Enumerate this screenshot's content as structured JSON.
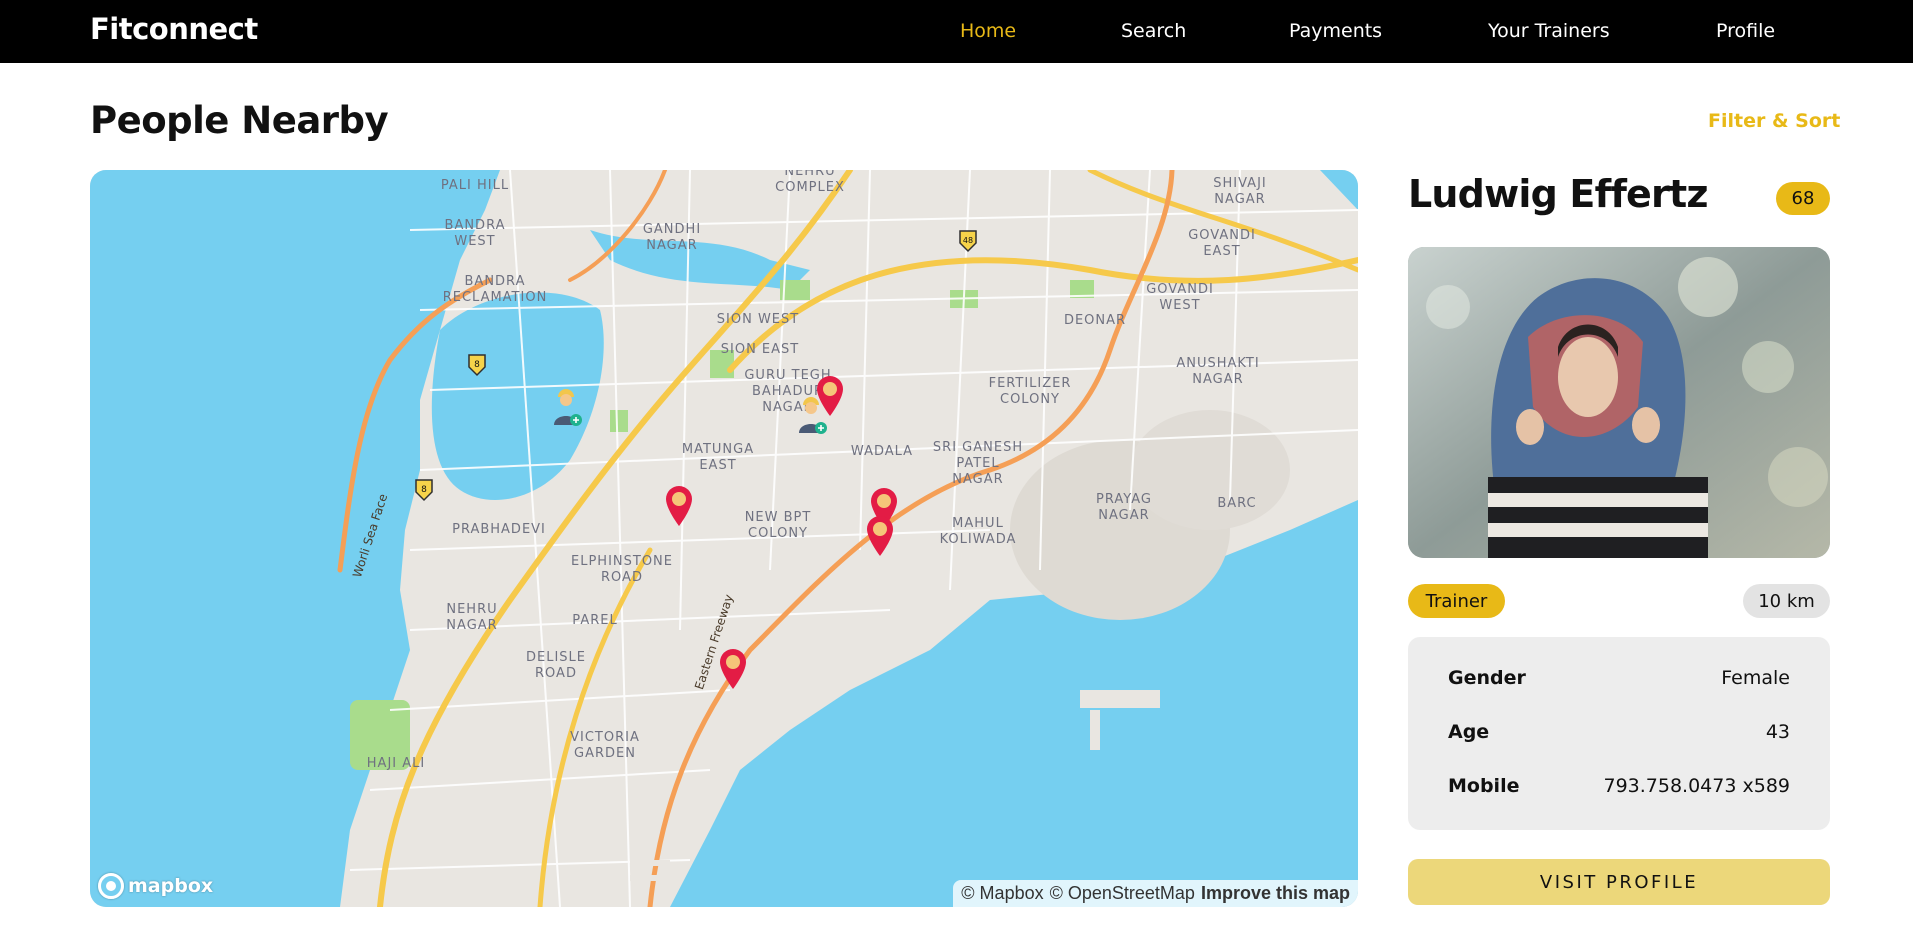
{
  "nav": {
    "brand": "Fitconnect",
    "links": [
      "Home",
      "Search",
      "Payments",
      "Your Trainers",
      "Profile"
    ],
    "active": "Home"
  },
  "header": {
    "title": "People Nearby",
    "filter_label": "Filter & Sort"
  },
  "map": {
    "place_labels": {
      "pali_hill": "PALI HILL",
      "nehru_complex": "NEHRU\nCOMPLEX",
      "shivaji_nagar": "SHIVAJI\nNAGAR",
      "bandra_west": "BANDRA\nWEST",
      "gandhi_nagar": "GANDHI\nNAGAR",
      "govandi_east": "GOVANDI\nEAST",
      "bandra_reclamation": "BANDRA\nRECLAMATION",
      "govandi_west": "GOVANDI\nWEST",
      "sion_west": "SION WEST",
      "deonar": "DEONAR",
      "sion_east": "SION EAST",
      "anushakti_nagar": "ANUSHAKTI\nNAGAR",
      "guru_tegh": "GURU TEGH\nBAHADUR\nNAGAR",
      "fertilizer_colony": "FERTILIZER\nCOLONY",
      "matunga_east": "MATUNGA\nEAST",
      "wadala": "WADALA",
      "sri_ganesh": "SRI GANESH\nPATEL\nNAGAR",
      "prayag_nagar": "PRAYAG\nNAGAR",
      "barc": "BARC",
      "new_bpt_colony": "NEW BPT\nCOLONY",
      "mahul_koliwada": "MAHUL\nKOLIWADA",
      "prabhadevi": "PRABHADEVI",
      "elphinstone_road": "ELPHINSTONE\nROAD",
      "nehru_nagar": "NEHRU\nNAGAR",
      "parel": "PAREL",
      "delisle_road": "DELISLE\nROAD",
      "victoria_garden": "VICTORIA\nGARDEN",
      "haji_ali": "HAJI ALI"
    },
    "road_labels": {
      "worli_sea_face": "Worli Sea Face",
      "eastern_freeway": "Eastern Freeway"
    },
    "shields": {
      "s8a": "8",
      "s8b": "8",
      "s48": "48"
    },
    "logo": "mapbox",
    "attribution": {
      "mapbox": "© Mapbox",
      "osm": "© OpenStreetMap",
      "improve": "Improve this map"
    },
    "colors": {
      "water": "#75cff0",
      "land": "#e9e6e1",
      "highway": "#f6c94a",
      "freeway": "#f59f56",
      "park": "#a9dc8c",
      "pin": "#e31c45"
    }
  },
  "profile": {
    "name": "Ludwig Effertz",
    "score": "68",
    "role": "Trainer",
    "distance": "10 km",
    "details": {
      "gender_label": "Gender",
      "gender": "Female",
      "age_label": "Age",
      "age": "43",
      "mobile_label": "Mobile",
      "mobile": "793.758.0473 x589"
    },
    "visit_label": "VISIT PROFILE"
  }
}
